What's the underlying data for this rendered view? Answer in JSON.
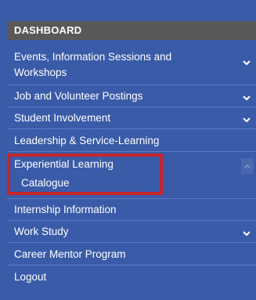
{
  "header": {
    "title": "DASHBOARD"
  },
  "menu": {
    "events": "Events, Information Sessions and Workshops",
    "jobs": "Job and Volunteer Postings",
    "involvement": "Student Involvement",
    "leadership": "Leadership & Service-Learning",
    "experiential": "Experiential Learning",
    "catalogue": "Catalogue",
    "internship": "Internship Information",
    "work_study": "Work Study",
    "mentor": "Career Mentor Program",
    "logout": "Logout"
  },
  "colors": {
    "panel": "#3a5ba8",
    "header": "#595959",
    "highlight_border": "#c8242b"
  },
  "icons": {
    "expand": "chevron-down-icon",
    "collapse": "chevron-up-icon"
  }
}
